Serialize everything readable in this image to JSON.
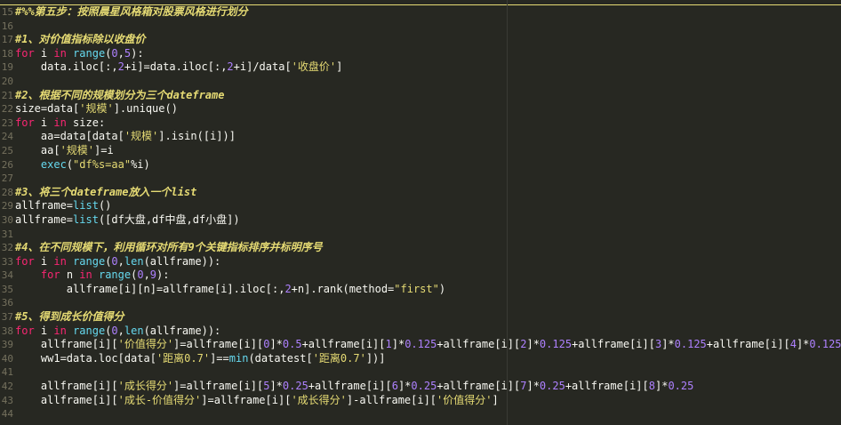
{
  "editor": {
    "lines": [
      {
        "n": "15",
        "t": [
          [
            "#%%第五步：按照晨星风格箱对股票风格进行划分",
            "cmt"
          ]
        ]
      },
      {
        "n": "16",
        "t": []
      },
      {
        "n": "17",
        "t": [
          [
            "#1、对价值指标除以收盘价",
            "cmt"
          ]
        ]
      },
      {
        "n": "18",
        "t": [
          [
            "for",
            "kw"
          ],
          [
            " i ",
            ""
          ],
          [
            "in",
            "kw"
          ],
          [
            " ",
            ""
          ],
          [
            "range",
            "bi"
          ],
          [
            "(",
            ""
          ],
          [
            "0",
            "num"
          ],
          [
            ",",
            ""
          ],
          [
            "5",
            "num"
          ],
          [
            "):",
            ""
          ]
        ]
      },
      {
        "n": "19",
        "t": [
          [
            "    data.iloc[:,",
            ""
          ],
          [
            "2",
            "num"
          ],
          [
            "+i]=data.iloc[:,",
            ""
          ],
          [
            "2",
            "num"
          ],
          [
            "+i]/data[",
            ""
          ],
          [
            "'收盘价'",
            "str"
          ],
          [
            "]",
            ""
          ]
        ]
      },
      {
        "n": "20",
        "t": []
      },
      {
        "n": "21",
        "t": [
          [
            "#2、根据不同的规模划分为三个dateframe",
            "cmt"
          ]
        ]
      },
      {
        "n": "22",
        "t": [
          [
            "size=data[",
            ""
          ],
          [
            "'规模'",
            "str"
          ],
          [
            "].unique()",
            ""
          ]
        ]
      },
      {
        "n": "23",
        "t": [
          [
            "for",
            "kw"
          ],
          [
            " i ",
            ""
          ],
          [
            "in",
            "kw"
          ],
          [
            " size:",
            ""
          ]
        ]
      },
      {
        "n": "24",
        "t": [
          [
            "    aa=data[data[",
            ""
          ],
          [
            "'规模'",
            "str"
          ],
          [
            "].isin([i])]",
            ""
          ]
        ]
      },
      {
        "n": "25",
        "t": [
          [
            "    aa[",
            ""
          ],
          [
            "'规模'",
            "str"
          ],
          [
            "]=i",
            ""
          ]
        ]
      },
      {
        "n": "26",
        "t": [
          [
            "    ",
            ""
          ],
          [
            "exec",
            "bi"
          ],
          [
            "(",
            ""
          ],
          [
            "\"df%s=aa\"",
            "str"
          ],
          [
            "%i)",
            ""
          ]
        ]
      },
      {
        "n": "27",
        "t": []
      },
      {
        "n": "28",
        "t": [
          [
            "#3、将三个dateframe放入一个list",
            "cmt"
          ]
        ]
      },
      {
        "n": "29",
        "t": [
          [
            "allframe=",
            ""
          ],
          [
            "list",
            "bi"
          ],
          [
            "()",
            ""
          ]
        ]
      },
      {
        "n": "30",
        "t": [
          [
            "allframe=",
            ""
          ],
          [
            "list",
            "bi"
          ],
          [
            "([df大盘,df中盘,df小盘])",
            ""
          ]
        ]
      },
      {
        "n": "31",
        "t": []
      },
      {
        "n": "32",
        "t": [
          [
            "#4、在不同规模下，利用循环对所有9个关键指标排序并标明序号",
            "cmt"
          ]
        ]
      },
      {
        "n": "33",
        "t": [
          [
            "for",
            "kw"
          ],
          [
            " i ",
            ""
          ],
          [
            "in",
            "kw"
          ],
          [
            " ",
            ""
          ],
          [
            "range",
            "bi"
          ],
          [
            "(",
            ""
          ],
          [
            "0",
            "num"
          ],
          [
            ",",
            ""
          ],
          [
            "len",
            "bi"
          ],
          [
            "(allframe)):",
            ""
          ]
        ]
      },
      {
        "n": "34",
        "t": [
          [
            "    ",
            ""
          ],
          [
            "for",
            "kw"
          ],
          [
            " n ",
            ""
          ],
          [
            "in",
            "kw"
          ],
          [
            " ",
            ""
          ],
          [
            "range",
            "bi"
          ],
          [
            "(",
            ""
          ],
          [
            "0",
            "num"
          ],
          [
            ",",
            ""
          ],
          [
            "9",
            "num"
          ],
          [
            "):",
            ""
          ]
        ]
      },
      {
        "n": "35",
        "t": [
          [
            "        allframe[i][n]=allframe[i].iloc[:,",
            ""
          ],
          [
            "2",
            "num"
          ],
          [
            "+n].rank(method=",
            ""
          ],
          [
            "\"first\"",
            "str"
          ],
          [
            ")",
            ""
          ]
        ]
      },
      {
        "n": "36",
        "t": []
      },
      {
        "n": "37",
        "t": [
          [
            "#5、得到成长价值得分",
            "cmt"
          ]
        ]
      },
      {
        "n": "38",
        "t": [
          [
            "for",
            "kw"
          ],
          [
            " i ",
            ""
          ],
          [
            "in",
            "kw"
          ],
          [
            " ",
            ""
          ],
          [
            "range",
            "bi"
          ],
          [
            "(",
            ""
          ],
          [
            "0",
            "num"
          ],
          [
            ",",
            ""
          ],
          [
            "len",
            "bi"
          ],
          [
            "(allframe)):",
            ""
          ]
        ]
      },
      {
        "n": "39",
        "t": [
          [
            "    allframe[i][",
            ""
          ],
          [
            "'价值得分'",
            "str"
          ],
          [
            "]=allframe[i][",
            ""
          ],
          [
            "0",
            "num"
          ],
          [
            "]*",
            ""
          ],
          [
            "0.5",
            "num"
          ],
          [
            "+allframe[i][",
            ""
          ],
          [
            "1",
            "num"
          ],
          [
            "]*",
            ""
          ],
          [
            "0.125",
            "num"
          ],
          [
            "+allframe[i][",
            ""
          ],
          [
            "2",
            "num"
          ],
          [
            "]*",
            ""
          ],
          [
            "0.125",
            "num"
          ],
          [
            "+allframe[i][",
            ""
          ],
          [
            "3",
            "num"
          ],
          [
            "]*",
            ""
          ],
          [
            "0.125",
            "num"
          ],
          [
            "+allframe[i][",
            ""
          ],
          [
            "4",
            "num"
          ],
          [
            "]*",
            ""
          ],
          [
            "0.125",
            "num"
          ]
        ]
      },
      {
        "n": "40",
        "t": [
          [
            "    ww1=data.loc[data[",
            ""
          ],
          [
            "'距离0.7'",
            "str"
          ],
          [
            "]==",
            ""
          ],
          [
            "min",
            "bi"
          ],
          [
            "(datatest[",
            ""
          ],
          [
            "'距离0.7'",
            "str"
          ],
          [
            "])]",
            ""
          ]
        ]
      },
      {
        "n": "41",
        "t": []
      },
      {
        "n": "42",
        "t": [
          [
            "    allframe[i][",
            ""
          ],
          [
            "'成长得分'",
            "str"
          ],
          [
            "]=allframe[i][",
            ""
          ],
          [
            "5",
            "num"
          ],
          [
            "]*",
            ""
          ],
          [
            "0.25",
            "num"
          ],
          [
            "+allframe[i][",
            ""
          ],
          [
            "6",
            "num"
          ],
          [
            "]*",
            ""
          ],
          [
            "0.25",
            "num"
          ],
          [
            "+allframe[i][",
            ""
          ],
          [
            "7",
            "num"
          ],
          [
            "]*",
            ""
          ],
          [
            "0.25",
            "num"
          ],
          [
            "+allframe[i][",
            ""
          ],
          [
            "8",
            "num"
          ],
          [
            "]*",
            ""
          ],
          [
            "0.25",
            "num"
          ]
        ]
      },
      {
        "n": "43",
        "t": [
          [
            "    allframe[i][",
            ""
          ],
          [
            "'成长-价值得分'",
            "str"
          ],
          [
            "]=allframe[i][",
            ""
          ],
          [
            "'成长得分'",
            "str"
          ],
          [
            "]-allframe[i][",
            ""
          ],
          [
            "'价值得分'",
            "str"
          ],
          [
            "]",
            ""
          ]
        ]
      },
      {
        "n": "44",
        "t": []
      }
    ]
  }
}
